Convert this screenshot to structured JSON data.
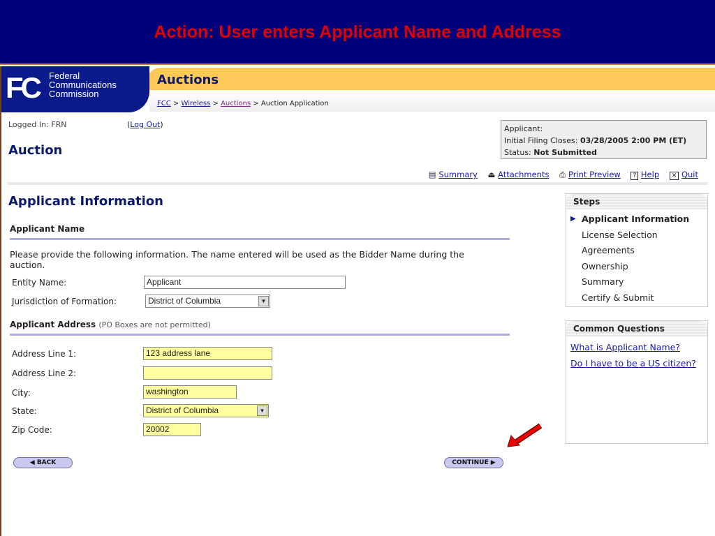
{
  "slide_title": "Action: User enters Applicant Name and Address",
  "logo": {
    "mark": "FC",
    "lines": [
      "Federal",
      "Communications",
      "Commission"
    ]
  },
  "header": {
    "title": "Auctions",
    "breadcrumb": [
      "FCC",
      "Wireless",
      "Auctions",
      "Auction Application"
    ],
    "sep": " > "
  },
  "session": {
    "logged_in": "Logged In: FRN",
    "logout": "Log Out"
  },
  "page_title": "Auction",
  "status_box": {
    "applicant_label": "Applicant:",
    "closes_label": "Initial Filing Closes: ",
    "closes_value": "03/28/2005 2:00 PM (ET)",
    "status_label": "Status: ",
    "status_value": "Not Submitted"
  },
  "toolbar": [
    {
      "icon": "summary-icon",
      "glyph": "▤",
      "label": "Summary"
    },
    {
      "icon": "attachments-icon",
      "glyph": "⏏",
      "label": "Attachments"
    },
    {
      "icon": "print-icon",
      "glyph": "⎙",
      "label": "Print Preview"
    },
    {
      "icon": "help-icon",
      "glyph": "?",
      "label": "Help"
    },
    {
      "icon": "quit-icon",
      "glyph": "✕",
      "label": "Quit"
    }
  ],
  "section_title": "Applicant Information",
  "name_section": {
    "heading": "Applicant Name",
    "intro": "Please provide the following information. The name entered will be used as the Bidder Name during the auction.",
    "entity_label": "Entity Name:",
    "entity_value": "Applicant",
    "jurisdiction_label": "Jurisdiction of Formation:",
    "jurisdiction_value": "District of Columbia"
  },
  "address_section": {
    "heading": "Applicant Address",
    "note": "(PO Boxes are not permitted)",
    "line1_label": "Address Line 1:",
    "line1_value": "123 address lane",
    "line2_label": "Address Line 2:",
    "line2_value": "",
    "city_label": "City:",
    "city_value": "washington",
    "state_label": "State:",
    "state_value": "District of Columbia",
    "zip_label": "Zip Code:",
    "zip_value": "20002"
  },
  "buttons": {
    "back": "◀ BACK",
    "continue": "CONTINUE ▶"
  },
  "steps": {
    "heading": "Steps",
    "items": [
      "Applicant Information",
      "License Selection",
      "Agreements",
      "Ownership",
      "Summary",
      "Certify & Submit"
    ],
    "current": 0
  },
  "questions": {
    "heading": "Common Questions",
    "items": [
      "What is Applicant Name?",
      "Do I have to be a US citizen?"
    ]
  },
  "colors": {
    "banner": "#00007a",
    "title_red": "#e00000",
    "header_yellow": "#ffc95a",
    "logo_blue": "#0a1a8a",
    "required_yellow": "#ffffa0"
  }
}
